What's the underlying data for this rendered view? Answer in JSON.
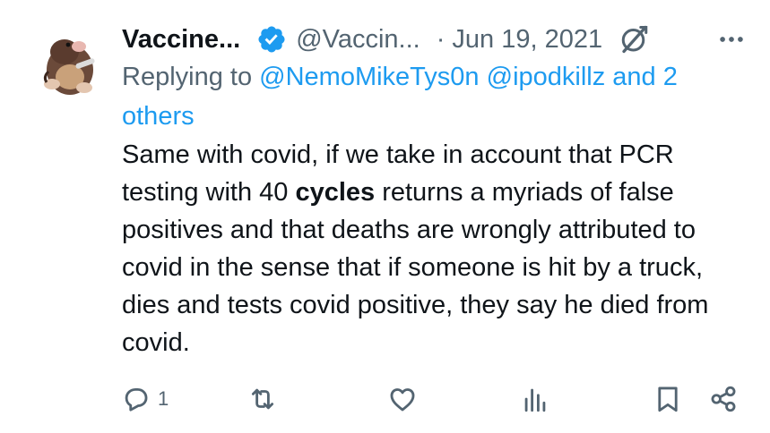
{
  "author": {
    "name": "Vaccine...",
    "handle": "@Vaccin...",
    "separator": "·",
    "date": "Jun 19, 2021"
  },
  "reply_context": {
    "prefix": "Replying to",
    "mention1": "@NemoMikeTys0n",
    "mention2": "@ipodkillz",
    "suffix": "and 2 others"
  },
  "tweet": {
    "text_part1": "Same with covid, if we take in account that PCR testing with 40 ",
    "text_bold": "cycles",
    "text_part2": " returns a myriads of false positives and that deaths are wrongly attributed to covid in the sense that if someone is hit by a truck, dies and tests covid positive, they say he died from covid."
  },
  "actions": {
    "reply_count": "1"
  },
  "icons": {
    "verified": "verified-badge-icon",
    "grok": "grok-icon",
    "more": "more-options-icon",
    "reply": "reply-icon",
    "retweet": "retweet-icon",
    "like": "like-icon",
    "views": "views-icon",
    "bookmark": "bookmark-icon",
    "share": "share-icon"
  },
  "colors": {
    "accent": "#1d9bf0",
    "text": "#0f1419",
    "muted": "#536471"
  }
}
